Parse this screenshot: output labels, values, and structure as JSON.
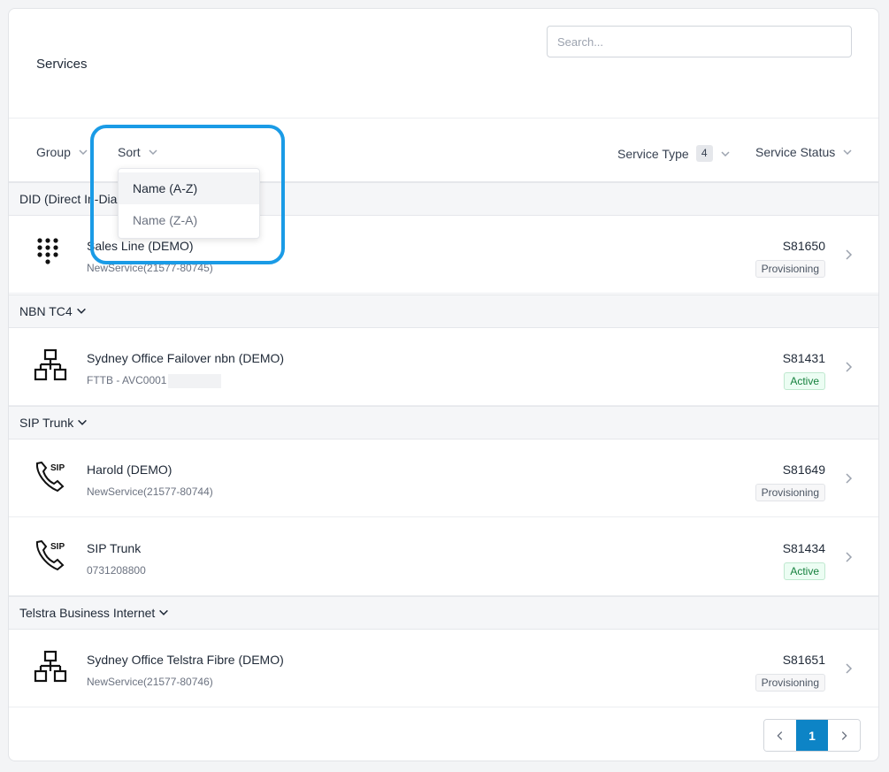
{
  "page": {
    "title": "Services"
  },
  "search": {
    "placeholder": "Search..."
  },
  "filters": {
    "group_label": "Group",
    "sort_label": "Sort",
    "service_type_label": "Service Type",
    "service_type_count": "4",
    "service_status_label": "Service Status"
  },
  "sort_menu": {
    "options": [
      {
        "label": "Name (A-Z)",
        "selected": true
      },
      {
        "label": "Name (Z-A)",
        "selected": false
      }
    ]
  },
  "groups": [
    {
      "label": "DID (Direct In-Dial)",
      "visible_label": "DID (Direct In-Dia",
      "rows": [
        {
          "icon": "keypad-icon",
          "name": "Sales Line (DEMO)",
          "sub": "NewService(21577-80745)",
          "id": "S81650",
          "status": "Provisioning"
        }
      ]
    },
    {
      "label": "NBN TC4",
      "rows": [
        {
          "icon": "network-icon",
          "name": "Sydney Office Failover nbn (DEMO)",
          "sub": "FTTB - AVC0001",
          "id": "S81431",
          "status": "Active"
        }
      ]
    },
    {
      "label": "SIP Trunk",
      "rows": [
        {
          "icon": "sip-phone-icon",
          "name": "Harold (DEMO)",
          "sub": "NewService(21577-80744)",
          "id": "S81649",
          "status": "Provisioning"
        },
        {
          "icon": "sip-phone-icon",
          "name": "SIP Trunk",
          "sub": "0731208800",
          "id": "S81434",
          "status": "Active"
        }
      ]
    },
    {
      "label": "Telstra Business Internet",
      "rows": [
        {
          "icon": "network-icon",
          "name": "Sydney Office Telstra Fibre (DEMO)",
          "sub": "NewService(21577-80746)",
          "id": "S81651",
          "status": "Provisioning"
        }
      ]
    }
  ],
  "pagination": {
    "current": "1"
  },
  "colors": {
    "accent": "#0d84c6",
    "highlight": "#1a9be6",
    "active_text": "#15803d"
  }
}
